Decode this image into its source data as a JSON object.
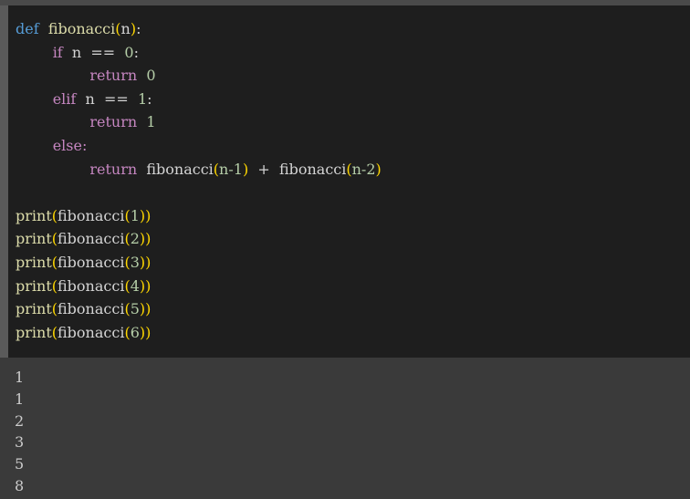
{
  "code": {
    "def_kw": "def",
    "fn_name": "fibonacci",
    "param": "n",
    "colon": ":",
    "if_kw": "if",
    "elif_kw": "elif",
    "else_kw": "else:",
    "return_kw": "return",
    "eq_op": "==",
    "plus_op": "+",
    "n_minus_1": "n-1",
    "n_minus_2": "n-2",
    "zero": "0",
    "one": "1",
    "print_fn": "print",
    "print_args": [
      "1",
      "2",
      "3",
      "4",
      "5",
      "6"
    ]
  },
  "output": {
    "lines": [
      "1",
      "1",
      "2",
      "3",
      "5",
      "8"
    ]
  },
  "colors": {
    "keyword_def": "#569cd6",
    "keyword_flow": "#c586c0",
    "function": "#dcdcaa",
    "bracket": "#ffd700",
    "number": "#b5cea8",
    "cell_background": "#1e1e1e",
    "output_background": "#3a3a3a"
  }
}
